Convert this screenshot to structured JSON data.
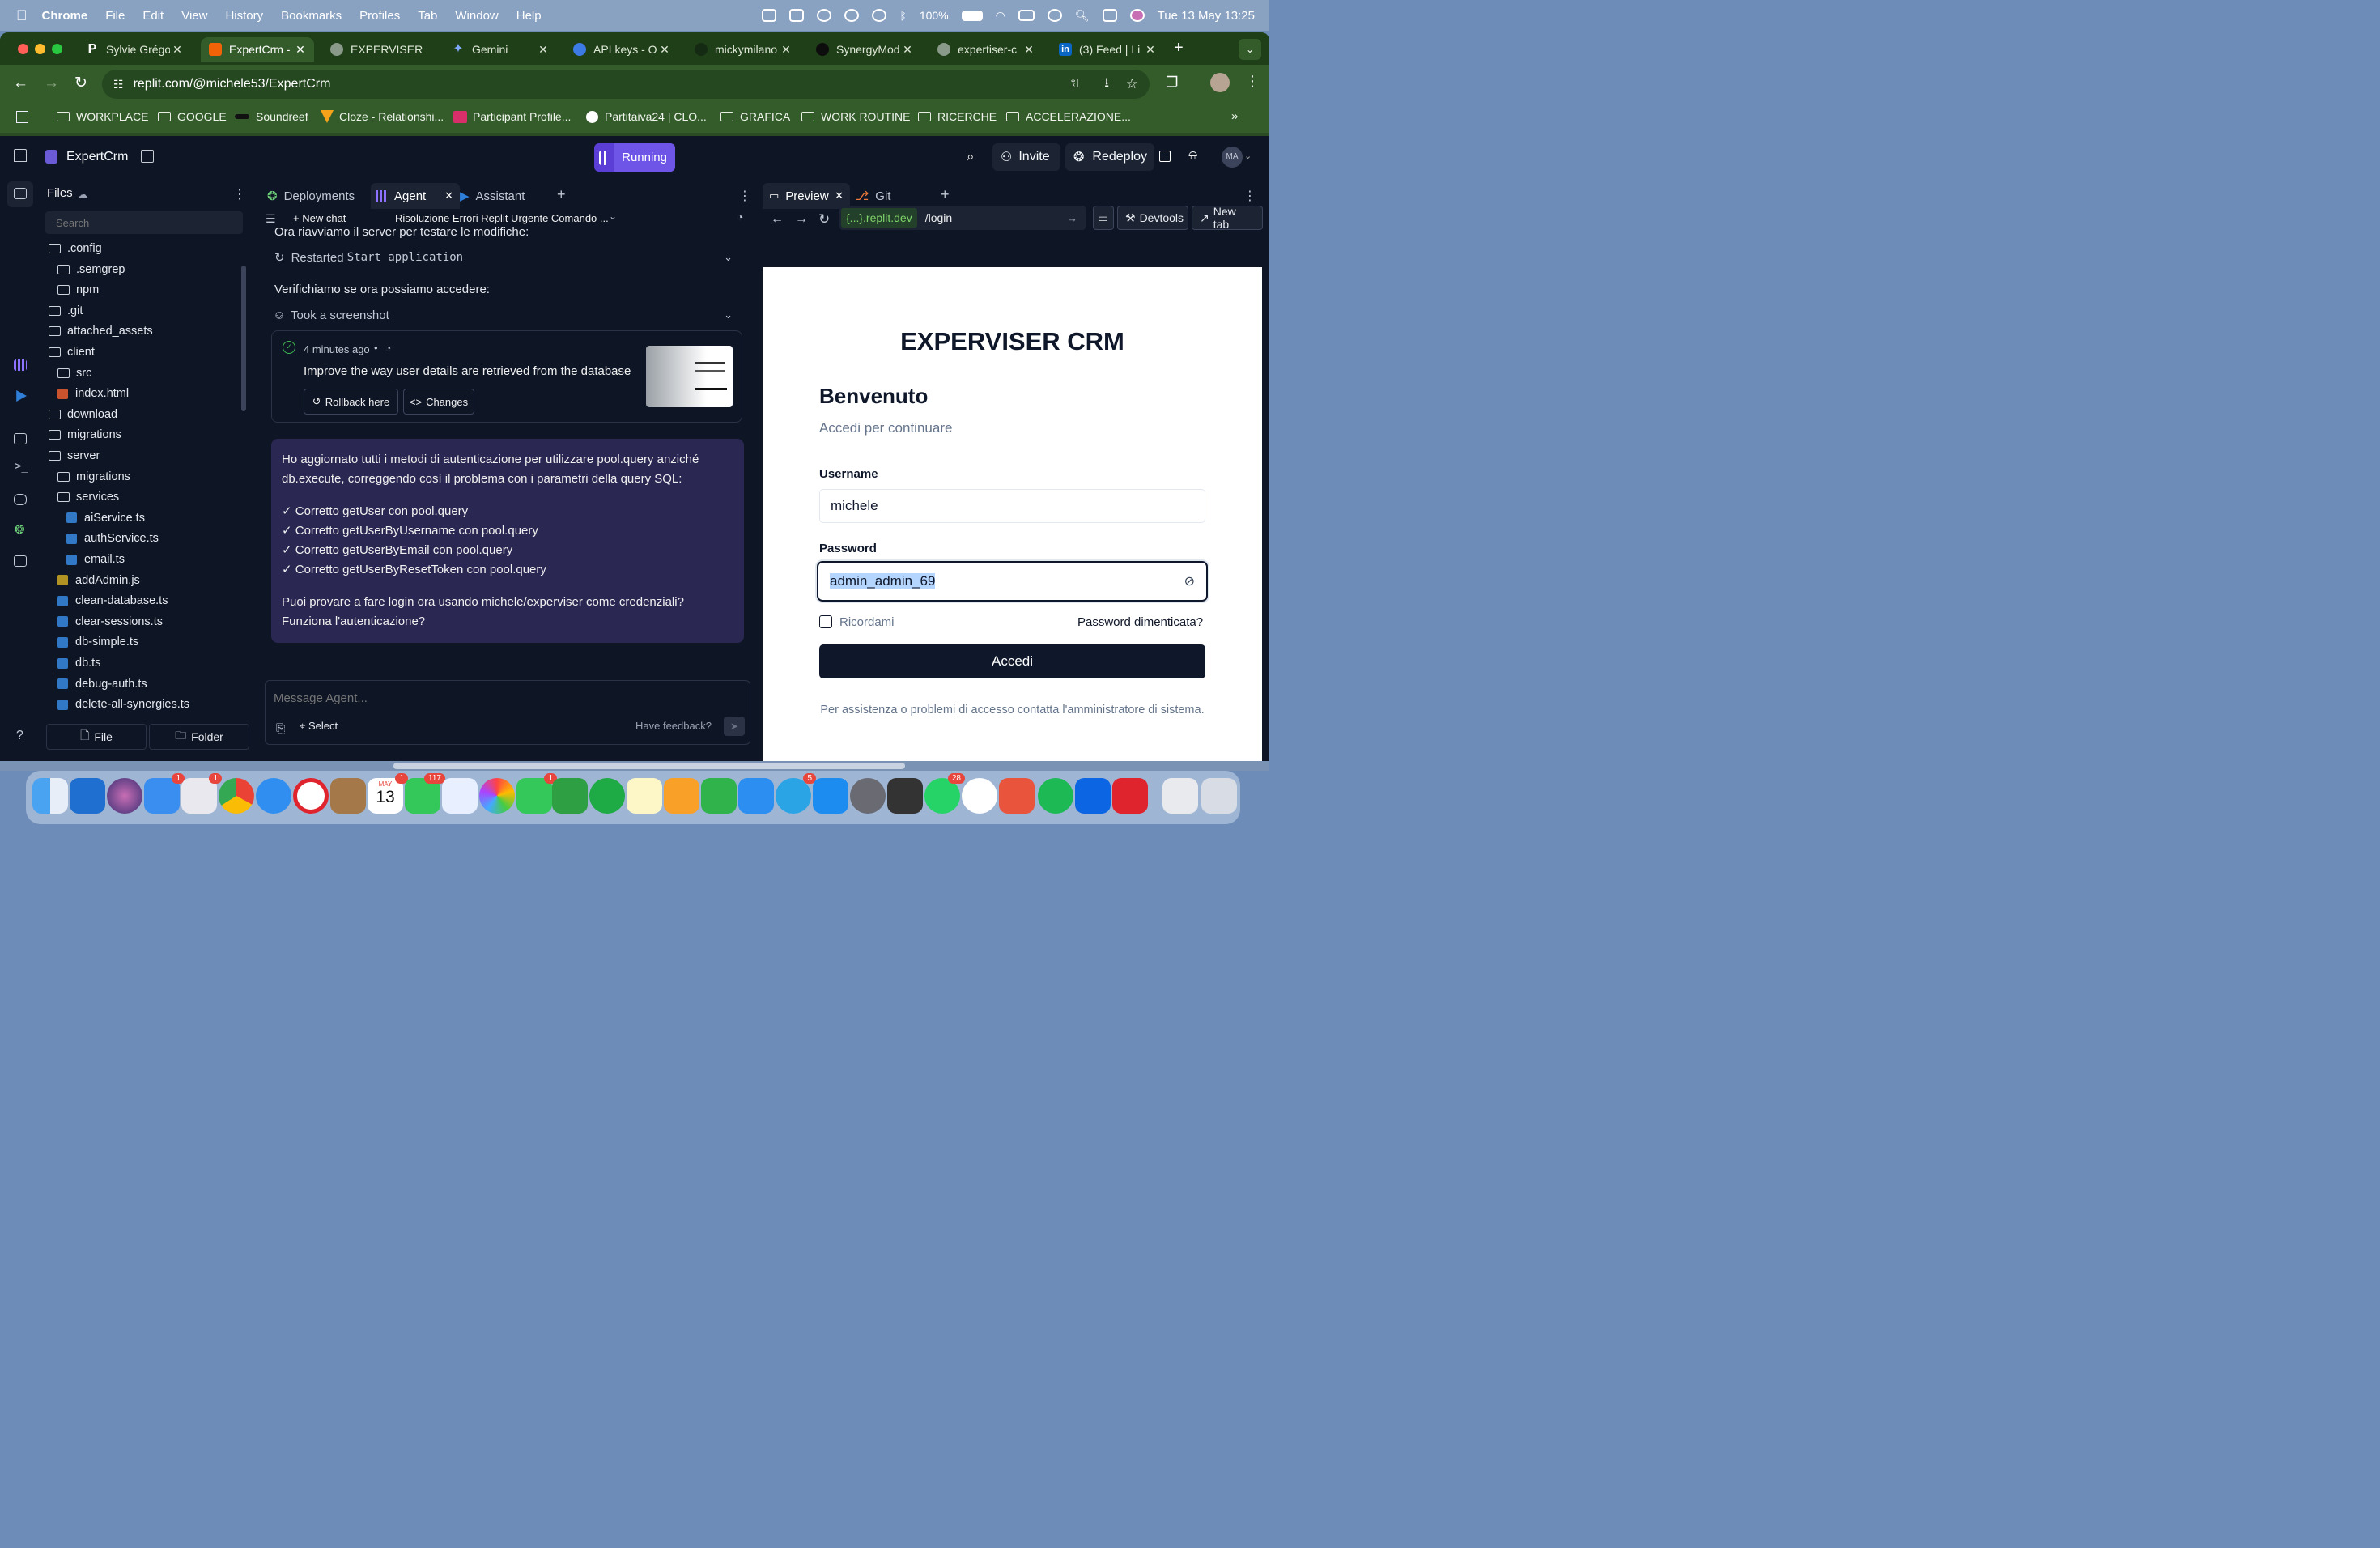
{
  "menubar": {
    "app": "Chrome",
    "items": [
      "File",
      "Edit",
      "View",
      "History",
      "Bookmarks",
      "Profiles",
      "Tab",
      "Window",
      "Help"
    ],
    "battery": "100%",
    "datetime": "Tue 13 May  13:25"
  },
  "browser": {
    "tabs": [
      {
        "label": "Sylvie Grégo",
        "fav": "P"
      },
      {
        "label": "ExpertCrm -",
        "fav": ""
      },
      {
        "label": "EXPERVISER",
        "fav": ""
      },
      {
        "label": "Gemini",
        "fav": ""
      },
      {
        "label": "API keys - O",
        "fav": ""
      },
      {
        "label": "mickymilano",
        "fav": ""
      },
      {
        "label": "SynergyMod",
        "fav": ""
      },
      {
        "label": "expertiser-c",
        "fav": ""
      },
      {
        "label": "(3) Feed | Li",
        "fav": "in"
      }
    ],
    "url": "replit.com/@michele53/ExpertCrm",
    "bookmarks": [
      "WORKPLACE",
      "GOOGLE",
      "Soundreef",
      "Cloze - Relationshi...",
      "Participant Profile...",
      "Partitaiva24 | CLO...",
      "GRAFICA",
      "WORK ROUTINE",
      "RICERCHE",
      "ACCELERAZIONE..."
    ]
  },
  "replit": {
    "project": "ExpertCrm",
    "status": "Running",
    "invite": "Invite",
    "redeploy": "Redeploy",
    "avatar": "MA",
    "files": {
      "title": "Files",
      "search_placeholder": "Search",
      "tree": [
        {
          "name": ".config",
          "type": "folder",
          "depth": 0
        },
        {
          "name": ".semgrep",
          "type": "folder",
          "depth": 1
        },
        {
          "name": "npm",
          "type": "folder",
          "depth": 1
        },
        {
          "name": ".git",
          "type": "folder",
          "depth": 0
        },
        {
          "name": "attached_assets",
          "type": "folder",
          "depth": 0
        },
        {
          "name": "client",
          "type": "folder",
          "depth": 0
        },
        {
          "name": "src",
          "type": "folder",
          "depth": 1
        },
        {
          "name": "index.html",
          "type": "html",
          "depth": 1
        },
        {
          "name": "download",
          "type": "folder",
          "depth": 0
        },
        {
          "name": "migrations",
          "type": "folder",
          "depth": 0
        },
        {
          "name": "server",
          "type": "folder",
          "depth": 0
        },
        {
          "name": "migrations",
          "type": "folder",
          "depth": 1
        },
        {
          "name": "services",
          "type": "folder",
          "depth": 1
        },
        {
          "name": "aiService.ts",
          "type": "ts",
          "depth": 2
        },
        {
          "name": "authService.ts",
          "type": "ts",
          "depth": 2
        },
        {
          "name": "email.ts",
          "type": "ts",
          "depth": 2
        },
        {
          "name": "addAdmin.js",
          "type": "js",
          "depth": 1
        },
        {
          "name": "clean-database.ts",
          "type": "ts",
          "depth": 1
        },
        {
          "name": "clear-sessions.ts",
          "type": "ts",
          "depth": 1
        },
        {
          "name": "db-simple.ts",
          "type": "ts",
          "depth": 1
        },
        {
          "name": "db.ts",
          "type": "ts",
          "depth": 1
        },
        {
          "name": "debug-auth.ts",
          "type": "ts",
          "depth": 1
        },
        {
          "name": "delete-all-synergies.ts",
          "type": "ts",
          "depth": 1
        }
      ],
      "file_button": "File",
      "folder_button": "Folder"
    },
    "center_tabs": [
      "Deployments",
      "Agent",
      "Assistant"
    ],
    "agent": {
      "new_chat": "New chat",
      "thread_title": "Risoluzione Errori Replit Urgente Comando ...",
      "msg1": "Ora riavviamo il server per testare le modifiche:",
      "action1_prefix": "Restarted",
      "action1_code": "Start application",
      "msg2": "Verifichiamo se ora possiamo accedere:",
      "action2": "Took a screenshot",
      "checkpoint_time": "4 minutes ago",
      "checkpoint_text": "Improve the way user details are retrieved from the database",
      "rollback": "Rollback here",
      "changes": "Changes",
      "reply_intro": "Ho aggiornato tutti i metodi di autenticazione per utilizzare pool.query anziché db.execute, correggendo così il problema con i parametri della query SQL:",
      "reply_items": [
        "✓ Corretto getUser con pool.query",
        "✓ Corretto getUserByUsername con pool.query",
        "✓ Corretto getUserByEmail con pool.query",
        "✓ Corretto getUserByResetToken con pool.query"
      ],
      "reply_outro": "Puoi provare a fare login ora usando michele/experviser come credenziali? Funziona l'autenticazione?",
      "input_placeholder": "Message Agent...",
      "select": "Select",
      "feedback": "Have feedback?"
    },
    "right_tabs": [
      "Preview",
      "Git"
    ],
    "preview": {
      "domain": "{...}.replit.dev",
      "path": "/login",
      "devtools": "Devtools",
      "new_tab": "New tab",
      "app_title": "EXPERVISER CRM",
      "welcome": "Benvenuto",
      "subtitle": "Accedi per continuare",
      "username_label": "Username",
      "username_value": "michele",
      "password_label": "Password",
      "password_value": "admin_admin_69",
      "remember": "Ricordami",
      "forgot": "Password dimenticata?",
      "submit": "Accedi",
      "help": "Per assistenza o problemi di accesso contatta l'amministratore di sistema."
    }
  },
  "dock": {
    "badges": {
      "mail": "1",
      "calendar": "1",
      "messages": "117",
      "facetime": "1",
      "telegram": "5",
      "whatsapp": "28",
      "launchpad": "1"
    },
    "calendar_month": "MAY",
    "calendar_day": "13"
  }
}
